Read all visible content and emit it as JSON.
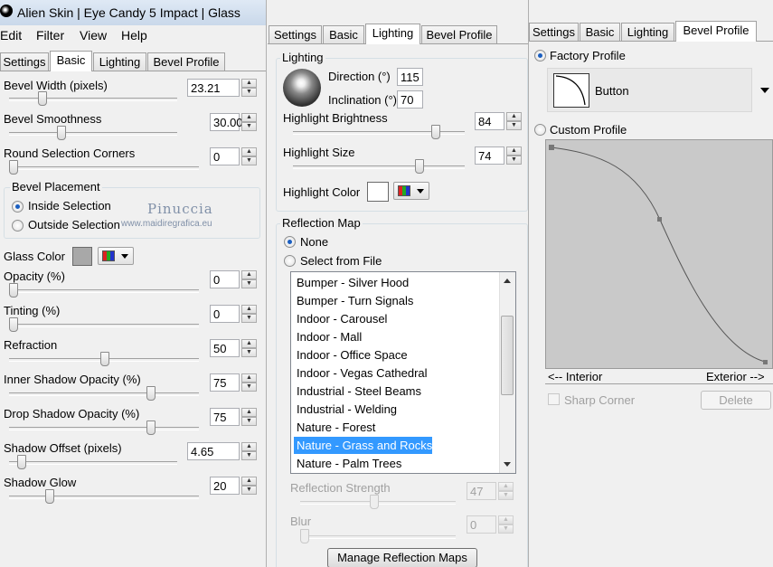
{
  "window": {
    "title": "Alien Skin | Eye Candy 5 Impact | Glass"
  },
  "menu": [
    "Edit",
    "Filter",
    "View",
    "Help"
  ],
  "tabs": [
    "Settings",
    "Basic",
    "Lighting",
    "Bevel Profile"
  ],
  "watermark": {
    "line1": "Pinuccia",
    "line2": "www.maidiregrafica.eu"
  },
  "basic": {
    "bevel_width": {
      "label": "Bevel Width (pixels)",
      "value": "23.21",
      "level": 0.18
    },
    "bevel_smoothness": {
      "label": "Bevel Smoothness",
      "value": "30.00",
      "level": 0.3
    },
    "round_corners": {
      "label": "Round Selection Corners",
      "value": "0",
      "level": 0.0
    },
    "bevel_placement": {
      "label": "Bevel Placement",
      "inside": "Inside Selection",
      "outside": "Outside Selection",
      "selected": "inside"
    },
    "glass_color": {
      "label": "Glass Color",
      "swatch": "#a8a8a8"
    },
    "opacity": {
      "label": "Opacity (%)",
      "value": "0",
      "level": 0.0
    },
    "tinting": {
      "label": "Tinting (%)",
      "value": "0",
      "level": 0.0
    },
    "refraction": {
      "label": "Refraction",
      "value": "50",
      "level": 0.5
    },
    "inner_shadow": {
      "label": "Inner Shadow Opacity (%)",
      "value": "75",
      "level": 0.75
    },
    "drop_shadow": {
      "label": "Drop Shadow Opacity (%)",
      "value": "75",
      "level": 0.75
    },
    "shadow_offset": {
      "label": "Shadow Offset (pixels)",
      "value": "4.65",
      "level": 0.05
    },
    "shadow_glow": {
      "label": "Shadow Glow",
      "value": "20",
      "level": 0.2
    }
  },
  "lighting": {
    "group_label": "Lighting",
    "direction": {
      "label": "Direction (°)",
      "value": "115"
    },
    "inclination": {
      "label": "Inclination (°)",
      "value": "70"
    },
    "highlight_brightness": {
      "label": "Highlight Brightness",
      "value": "84",
      "level": 0.84
    },
    "highlight_size": {
      "label": "Highlight Size",
      "value": "74",
      "level": 0.74
    },
    "highlight_color": {
      "label": "Highlight Color",
      "swatch": "#ffffff"
    },
    "reflection_map": {
      "label": "Reflection Map",
      "none": "None",
      "from_file": "Select from File",
      "selected": "none",
      "items": [
        "Bumper - Silver Hood",
        "Bumper - Turn Signals",
        "Indoor - Carousel",
        "Indoor - Mall",
        "Indoor - Office Space",
        "Indoor - Vegas Cathedral",
        "Industrial - Steel Beams",
        "Industrial - Welding",
        "Nature - Forest",
        "Nature - Grass and Rocks",
        "Nature - Palm Trees"
      ],
      "selected_item": "Nature - Grass and Rocks"
    },
    "reflection_strength": {
      "label": "Reflection Strength",
      "value": "47",
      "level": 0.47
    },
    "blur": {
      "label": "Blur",
      "value": "0",
      "level": 0.0
    },
    "manage_button": "Manage Reflection Maps"
  },
  "bevel_profile": {
    "factory_label": "Factory Profile",
    "factory_name": "Button",
    "custom_label": "Custom Profile",
    "selected": "factory",
    "interior_label": "<-- Interior",
    "exterior_label": "Exterior -->",
    "sharp_corner": "Sharp Corner",
    "delete_button": "Delete"
  }
}
